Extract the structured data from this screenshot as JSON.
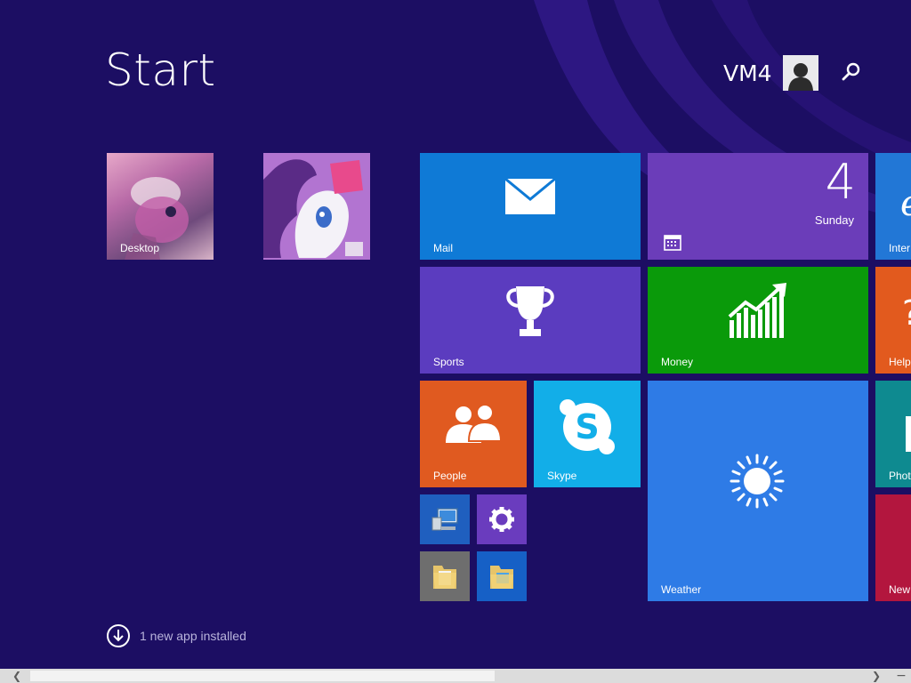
{
  "screen": {
    "title": "Start"
  },
  "user": {
    "name": "VM4"
  },
  "apps": [
    {
      "label": "Desktop"
    },
    {
      "label": ""
    }
  ],
  "tiles": {
    "mail": "Mail",
    "calendar": {
      "day_number": "4",
      "day_name": "Sunday"
    },
    "internet": "Inter",
    "sports": "Sports",
    "money": "Money",
    "help": "Help",
    "people": "People",
    "skype": "Skype",
    "weather": "Weather",
    "photos": "Phot",
    "news": "New"
  },
  "notification": {
    "text": "1 new app installed"
  },
  "colors": {
    "background": "#1c0e63",
    "mail": "#0f7ad6",
    "calendar": "#6b3db9",
    "sports": "#5b3cbf",
    "money": "#0a9a0a",
    "people": "#e05a20",
    "skype": "#12aee8",
    "weather": "#2e7be6",
    "news": "#b3163e"
  },
  "icons": [
    "mail-icon",
    "calendar-icon",
    "trophy-icon",
    "chart-icon",
    "people-icon",
    "skype-icon",
    "sun-icon",
    "search-icon",
    "user-avatar-icon",
    "download-arrow-icon",
    "computer-icon",
    "gear-icon",
    "folder-icon"
  ]
}
